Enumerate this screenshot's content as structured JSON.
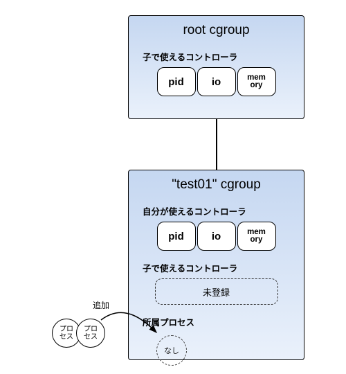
{
  "diagram": {
    "root_box": {
      "title": "root cgroup",
      "child_ctrl_label": "子で使えるコントローラ",
      "controllers": {
        "pid": "pid",
        "io": "io",
        "memory": "mem\nory"
      }
    },
    "test01_box": {
      "title": "\"test01\" cgroup",
      "self_ctrl_label": "自分が使えるコントローラ",
      "controllers": {
        "pid": "pid",
        "io": "io",
        "memory": "mem\nory"
      },
      "child_ctrl_label": "子で使えるコントローラ",
      "child_unregistered": "未登録",
      "proc_label": "所属プロセス",
      "proc_none": "なし"
    },
    "outside": {
      "proc_a": "プロ\nセス",
      "proc_b": "プロ\nセス",
      "add_label": "追加"
    }
  },
  "chart_data": {
    "type": "diagram",
    "nodes": [
      {
        "id": "root",
        "label": "root cgroup",
        "child_controllers": [
          "pid",
          "io",
          "memory"
        ]
      },
      {
        "id": "test01",
        "label": "\"test01\" cgroup",
        "self_controllers": [
          "pid",
          "io",
          "memory"
        ],
        "child_controllers": "未登録",
        "processes": "なし"
      },
      {
        "id": "procA",
        "label": "プロセス"
      },
      {
        "id": "procB",
        "label": "プロセス"
      }
    ],
    "edges": [
      {
        "from": "root",
        "to": "test01",
        "kind": "child"
      },
      {
        "from": "procB",
        "to": "test01.processes",
        "kind": "add",
        "label": "追加"
      }
    ]
  }
}
